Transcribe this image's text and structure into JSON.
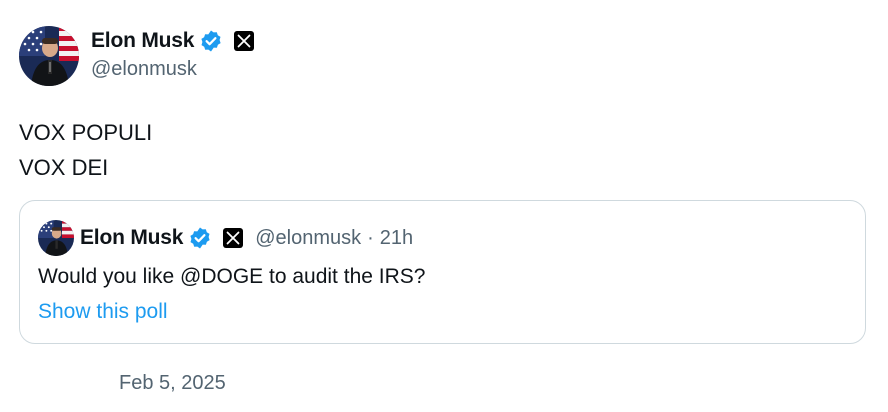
{
  "author": {
    "display_name": "Elon Musk",
    "handle": "@elonmusk",
    "verified_icon": "verified-badge-icon",
    "affiliation_icon": "x-logo-icon"
  },
  "post": {
    "lines": [
      "VOX POPULI",
      "VOX DEI"
    ],
    "date": "Feb 5, 2025"
  },
  "quoted_post": {
    "display_name": "Elon Musk",
    "handle": "@elonmusk",
    "separator": "·",
    "time": "21h",
    "text": "Would you like @DOGE to audit the IRS?",
    "link_label": "Show this poll"
  },
  "colors": {
    "text": "#0f1419",
    "secondary": "#536471",
    "link": "#1d9bf0",
    "verified": "#1d9bf0",
    "border": "#cfd9de"
  }
}
